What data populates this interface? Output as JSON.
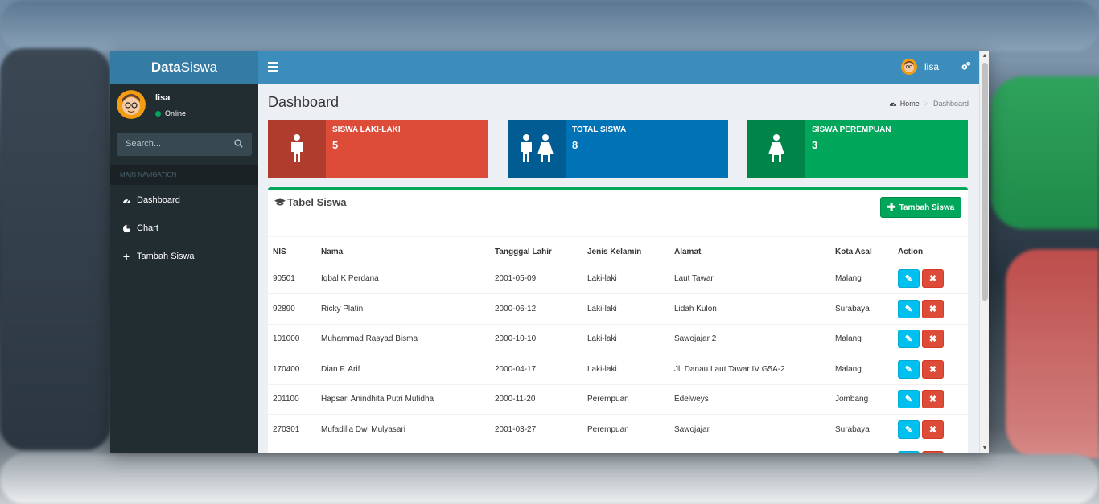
{
  "app": {
    "logo_bold": "Data",
    "logo_rest": "Siswa"
  },
  "navbar": {
    "user_name": "lisa",
    "gear_icon": "cogs-icon"
  },
  "sidebar": {
    "user_name": "lisa",
    "status": "Online",
    "search_placeholder": "Search...",
    "nav_header": "MAIN NAVIGATION",
    "items": [
      {
        "label": "Dashboard",
        "icon": "dashboard-icon"
      },
      {
        "label": "Chart",
        "icon": "pie-chart-icon"
      },
      {
        "label": "Tambah Siswa",
        "icon": "plus-icon"
      }
    ]
  },
  "page": {
    "title": "Dashboard",
    "breadcrumb_home": "Home",
    "breadcrumb_current": "Dashboard"
  },
  "info_boxes": [
    {
      "label": "SISWA LAKI-LAKI",
      "value": "5",
      "color": "#dd4b39"
    },
    {
      "label": "TOTAL SISWA",
      "value": "8",
      "color": "#0073b7"
    },
    {
      "label": "SISWA PEREMPUAN",
      "value": "3",
      "color": "#00a65a"
    }
  ],
  "table_box": {
    "title": "Tabel Siswa",
    "add_button": "Tambah Siswa",
    "columns": [
      "NIS",
      "Nama",
      "Tangggal Lahir",
      "Jenis Kelamin",
      "Alamat",
      "Kota Asal",
      "Action"
    ],
    "rows": [
      [
        "90501",
        "Iqbal K Perdana",
        "2001-05-09",
        "Laki-laki",
        "Laut Tawar",
        "Malang"
      ],
      [
        "92890",
        "Ricky Platin",
        "2000-06-12",
        "Laki-laki",
        "Lidah Kulon",
        "Surabaya"
      ],
      [
        "101000",
        "Muhammad Rasyad Bisma",
        "2000-10-10",
        "Laki-laki",
        "Sawojajar 2",
        "Malang"
      ],
      [
        "170400",
        "Dian F. Arif",
        "2000-04-17",
        "Laki-laki",
        "Jl. Danau Laut Tawar IV G5A-2",
        "Malang"
      ],
      [
        "201100",
        "Hapsari Anindhita Putri Mufidha",
        "2000-11-20",
        "Perempuan",
        "Edelweys",
        "Jombang"
      ],
      [
        "270301",
        "Mufadilla Dwi Mulyasari",
        "2001-03-27",
        "Perempuan",
        "Sawojajar",
        "Surabaya"
      ]
    ]
  },
  "colors": {
    "header": "#3c8dbc",
    "sidebar": "#222d32",
    "success": "#00a65a",
    "danger": "#dd4b39",
    "info": "#00c0ef"
  }
}
